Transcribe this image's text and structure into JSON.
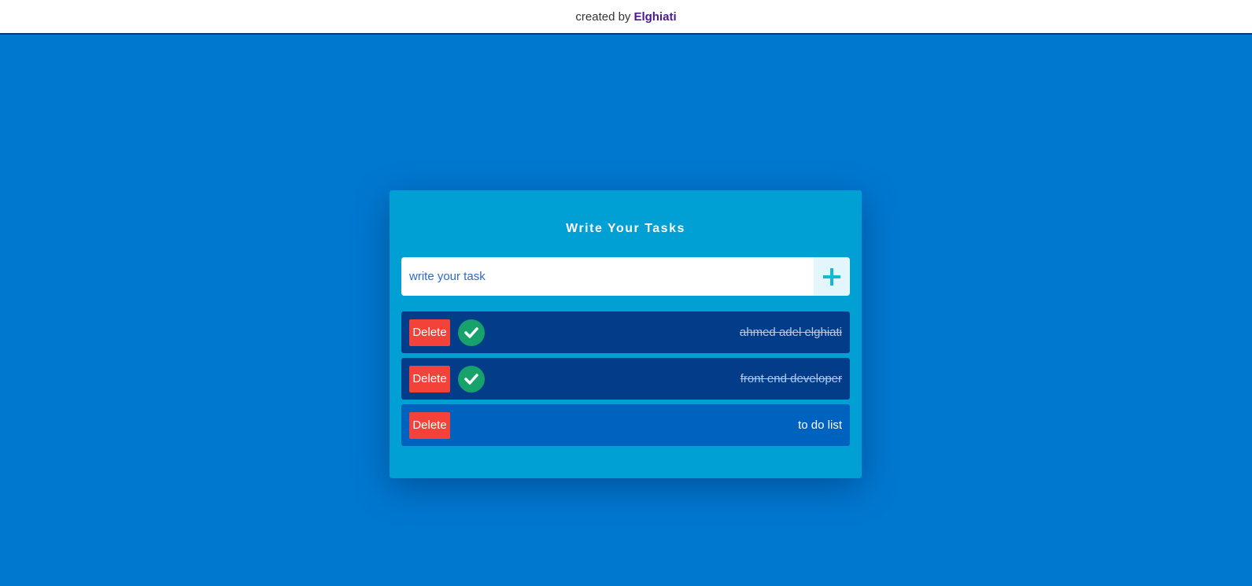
{
  "header": {
    "prefix": "created by",
    "author": "Elghiati"
  },
  "card": {
    "title": "Write Your Tasks"
  },
  "input": {
    "placeholder": "write your task",
    "add_icon": "plus-icon"
  },
  "tasks": [
    {
      "text": "ahmed adel elghiati",
      "delete_label": "Delete",
      "completed": true
    },
    {
      "text": "front end developer",
      "delete_label": "Delete",
      "completed": true
    },
    {
      "text": "to do list",
      "delete_label": "Delete",
      "completed": false
    }
  ],
  "colors": {
    "background": "#0078d0",
    "card": "#009fd4",
    "task_done": "#033c89",
    "task_pending": "#0062bf",
    "delete": "#f2423a",
    "check": "#16a26a",
    "author": "#4b1a8c"
  }
}
